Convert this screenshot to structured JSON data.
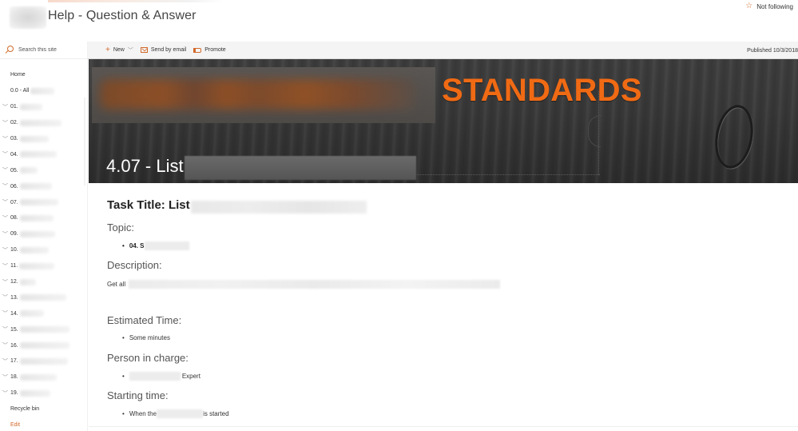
{
  "header": {
    "site_title": "Help - Question & Answer",
    "follow_label": "Not following",
    "follow_icon": "star-outline-icon"
  },
  "left_nav": {
    "search_placeholder": "Search this site",
    "items": [
      {
        "label": "Home",
        "expandable": false,
        "redacted": false
      },
      {
        "label": "0.0 - All",
        "expandable": false,
        "redacted": true
      },
      {
        "label": "01.",
        "expandable": true,
        "redacted": true
      },
      {
        "label": "02.",
        "expandable": true,
        "redacted": true
      },
      {
        "label": "03.",
        "expandable": true,
        "redacted": true
      },
      {
        "label": "04.",
        "expandable": true,
        "redacted": true
      },
      {
        "label": "05.",
        "expandable": true,
        "redacted": true
      },
      {
        "label": "06.",
        "expandable": true,
        "redacted": true
      },
      {
        "label": "07.",
        "expandable": true,
        "redacted": true
      },
      {
        "label": "08.",
        "expandable": true,
        "redacted": true
      },
      {
        "label": "09.",
        "expandable": true,
        "redacted": true
      },
      {
        "label": "10.",
        "expandable": true,
        "redacted": true
      },
      {
        "label": "11.",
        "expandable": true,
        "redacted": true
      },
      {
        "label": "12.",
        "expandable": true,
        "redacted": true
      },
      {
        "label": "13.",
        "expandable": true,
        "redacted": true
      },
      {
        "label": "14.",
        "expandable": true,
        "redacted": true
      },
      {
        "label": "15.",
        "expandable": true,
        "redacted": true
      },
      {
        "label": "16.",
        "expandable": true,
        "redacted": true
      },
      {
        "label": "17.",
        "expandable": true,
        "redacted": true
      },
      {
        "label": "18.",
        "expandable": true,
        "redacted": true
      },
      {
        "label": "19.",
        "expandable": true,
        "redacted": true
      },
      {
        "label": "Recycle bin",
        "expandable": false,
        "redacted": false
      },
      {
        "label": "Edit",
        "expandable": false,
        "redacted": false,
        "accent": true
      }
    ]
  },
  "command_bar": {
    "new_label": "New",
    "send_email_label": "Send by email",
    "promote_label": "Promote",
    "published_label": "Published 10/3/2018"
  },
  "banner": {
    "graphic_text": "STANDARDS",
    "page_title": "4.07 - List"
  },
  "content": {
    "task_title": "Task Title: List",
    "topic_label": "Topic:",
    "topic_value": "04. S",
    "description_label": "Description:",
    "description_value": "Get all",
    "estimated_time_label": "Estimated Time:",
    "estimated_time_value": "Some minutes",
    "person_label": "Person in charge:",
    "person_value": "Expert",
    "starting_time_label": "Starting time:",
    "starting_time_prefix": "When the",
    "starting_time_suffix": "is started"
  },
  "colors": {
    "accent": "#d26a2a",
    "banner_text": "#f06a14",
    "command_bar_bg": "#f4f4f4"
  }
}
